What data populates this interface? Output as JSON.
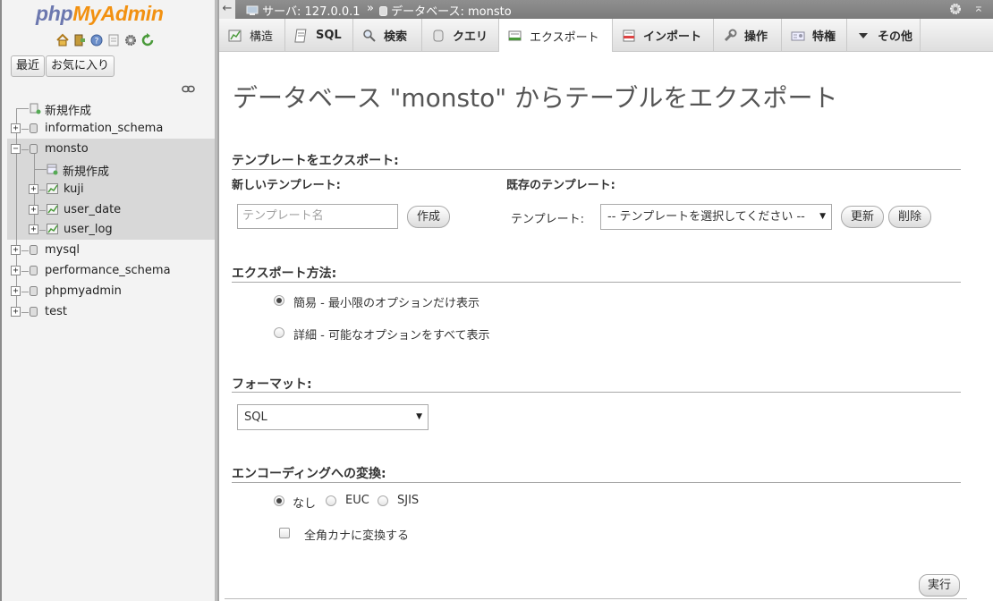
{
  "app": {
    "logo_php": "php",
    "logo_myadmin": "MyAdmin"
  },
  "nav": {
    "recent_button": "最近",
    "favorites_button": "お気に入り",
    "tree": {
      "new_item": "新規作成",
      "databases": [
        "information_schema",
        "monsto",
        "mysql",
        "performance_schema",
        "phpmyadmin",
        "test"
      ],
      "monsto_new_item": "新規作成",
      "monsto_tables": [
        "kuji",
        "user_date",
        "user_log"
      ]
    }
  },
  "topbar": {
    "server_label": "サーバ: 127.0.0.1",
    "separator": "»",
    "database_label": "データベース: monsto"
  },
  "tabs": [
    {
      "label": "構造"
    },
    {
      "label": "SQL"
    },
    {
      "label": "検索"
    },
    {
      "label": "クエリ"
    },
    {
      "label": "エクスポート"
    },
    {
      "label": "インポート"
    },
    {
      "label": "操作"
    },
    {
      "label": "特権"
    },
    {
      "label": "その他"
    }
  ],
  "main": {
    "title": "データベース \"monsto\" からテーブルをエクスポート",
    "template_section": {
      "title": "テンプレートをエクスポート:",
      "new_template_label": "新しいテンプレート:",
      "template_name_placeholder": "テンプレート名",
      "create_button": "作成",
      "existing_template_label": "既存のテンプレート:",
      "template_label": "テンプレート:",
      "template_select_value": "-- テンプレートを選択してください --",
      "update_button": "更新",
      "delete_button": "削除"
    },
    "export_method": {
      "title": "エクスポート方法:",
      "options": [
        {
          "label": "簡易 - 最小限のオプションだけ表示",
          "checked": true
        },
        {
          "label": "詳細 - 可能なオプションをすべて表示",
          "checked": false
        }
      ]
    },
    "format": {
      "title": "フォーマット:",
      "value": "SQL"
    },
    "encoding": {
      "title": "エンコーディングへの変換:",
      "options": [
        {
          "label": "なし",
          "checked": true
        },
        {
          "label": "EUC",
          "checked": false
        },
        {
          "label": "SJIS",
          "checked": false
        }
      ],
      "kana_checkbox_label": "全角カナに変換する",
      "kana_checked": false
    },
    "go_button": "実行"
  }
}
